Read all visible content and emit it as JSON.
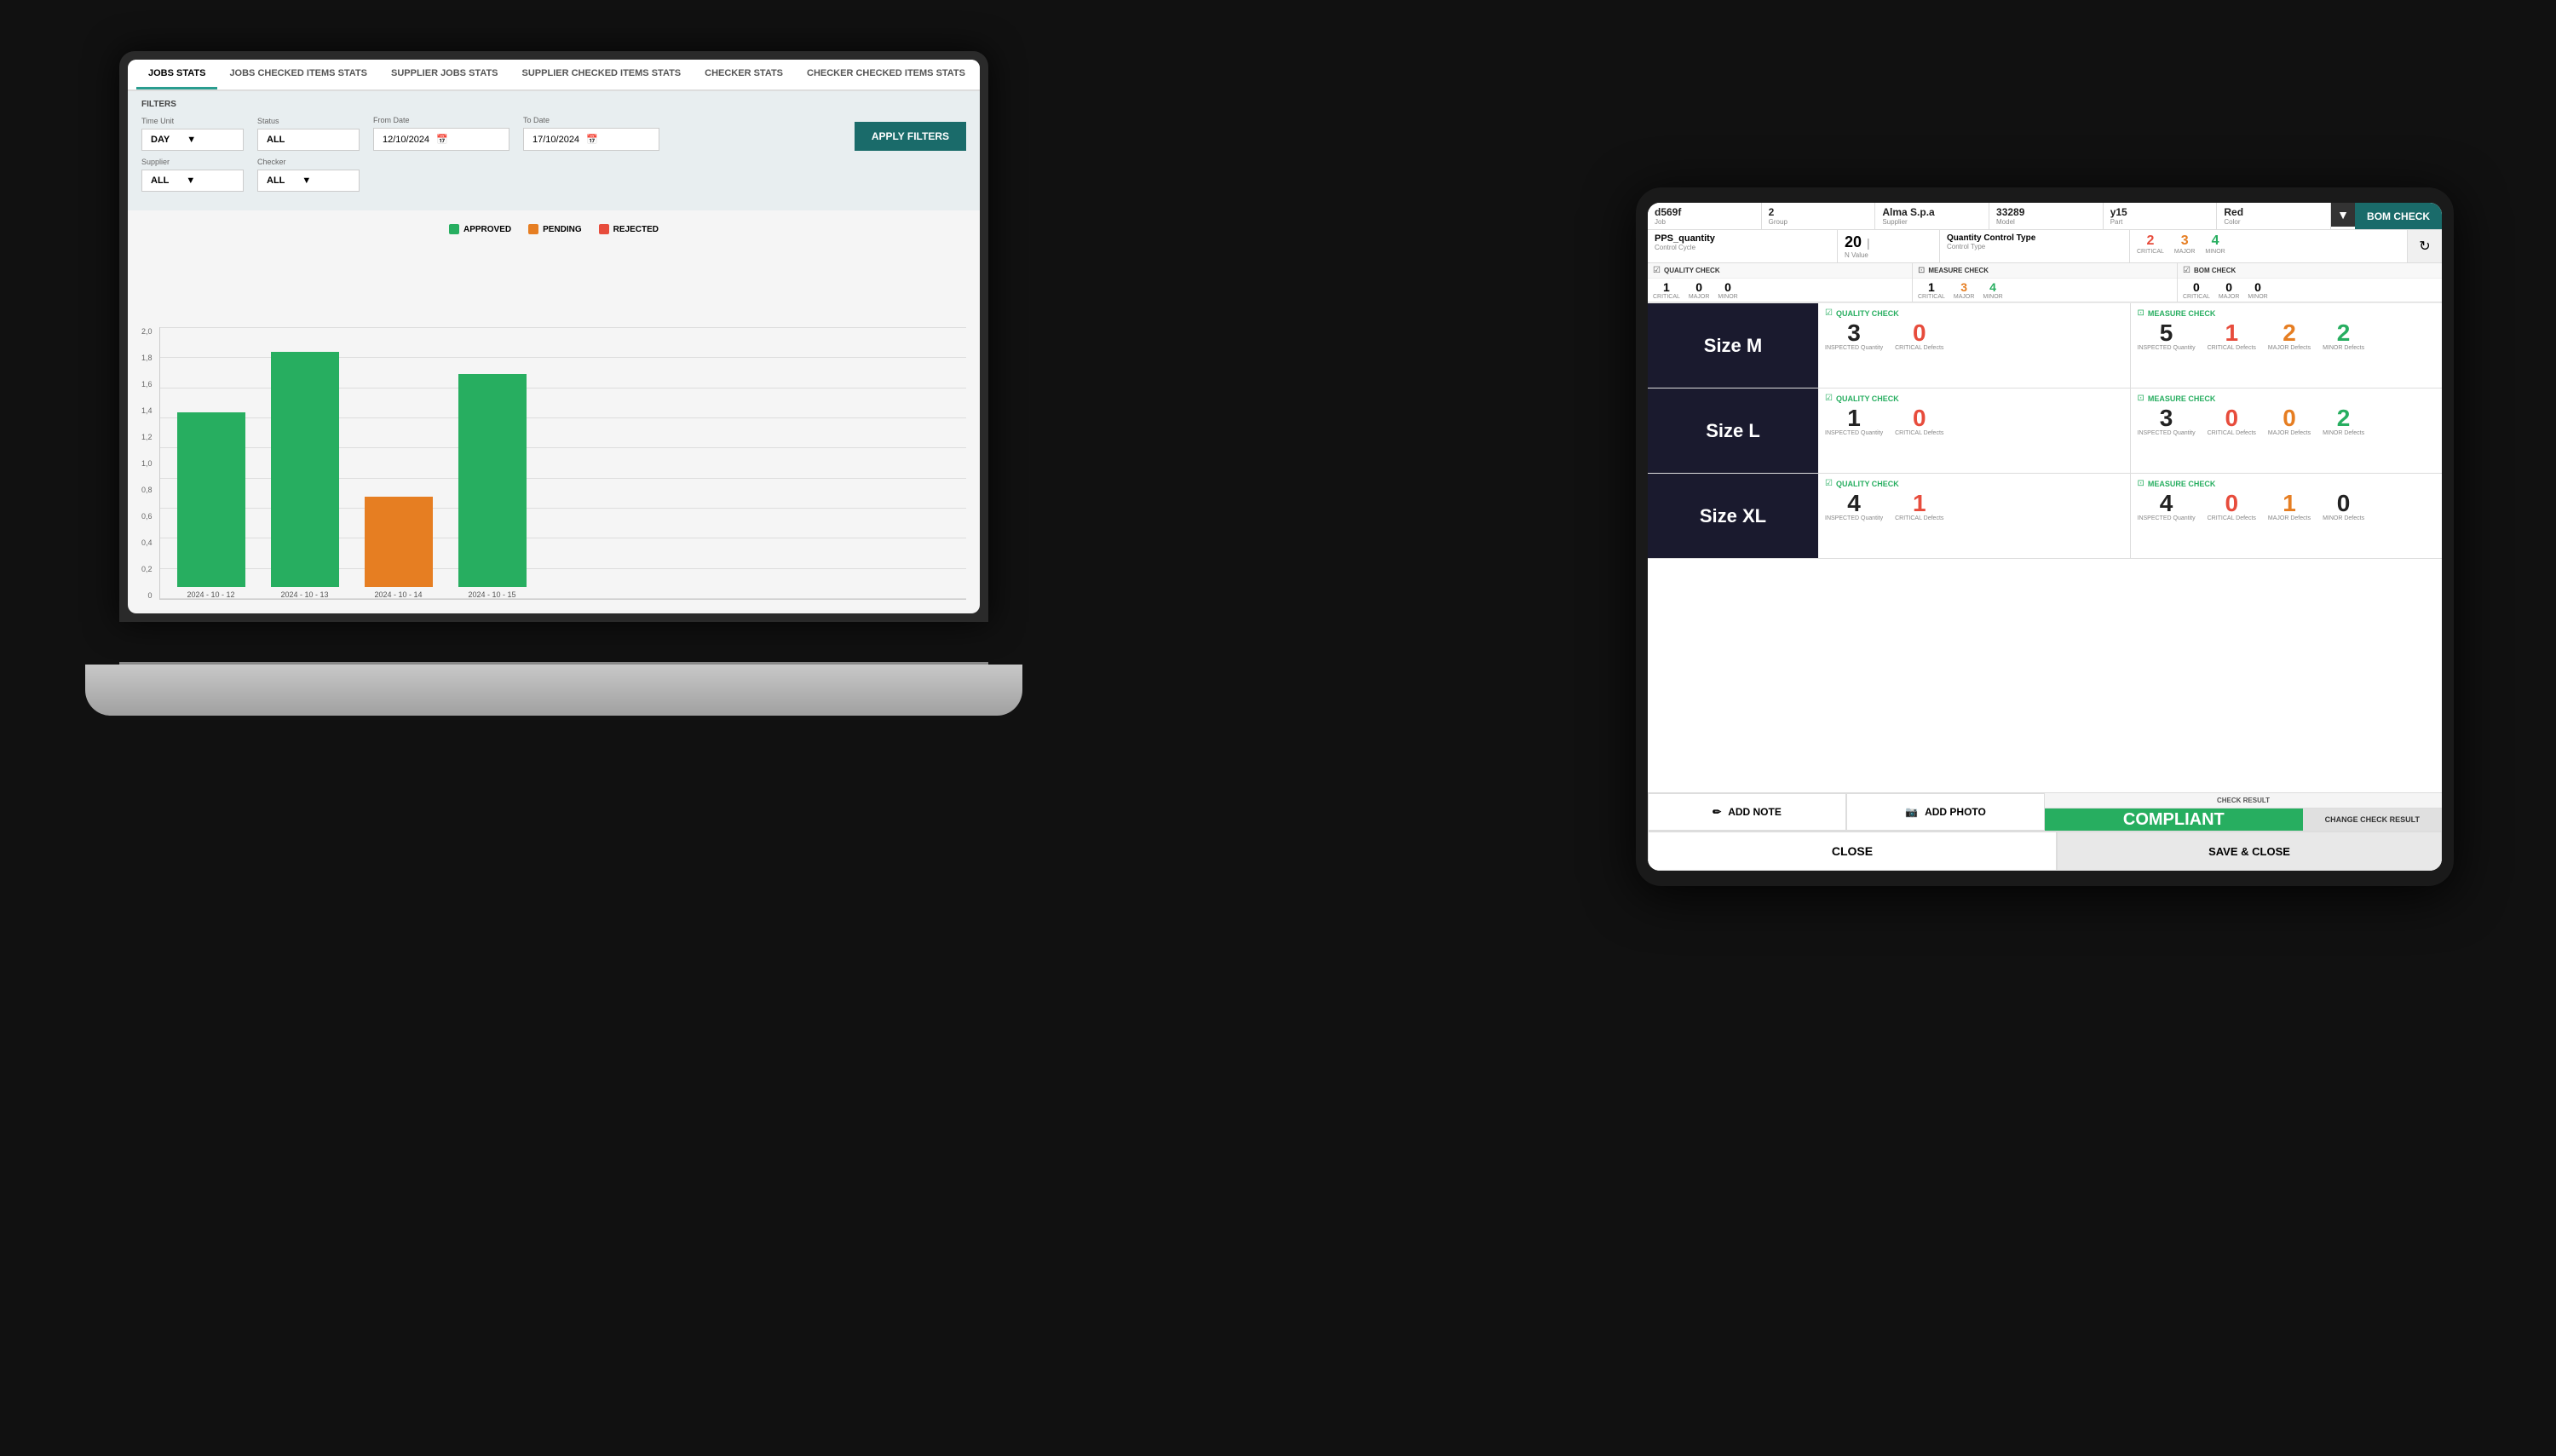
{
  "background": "#111111",
  "laptop": {
    "stats_app": {
      "tabs": [
        {
          "label": "JOBS STATS",
          "active": true
        },
        {
          "label": "JOBS CHECKED ITEMS STATS",
          "active": false
        },
        {
          "label": "SUPPLIER JOBS STATS",
          "active": false
        },
        {
          "label": "SUPPLIER CHECKED ITEMS STATS",
          "active": false
        },
        {
          "label": "CHECKER STATS",
          "active": false
        },
        {
          "label": "CHECKER CHECKED ITEMS STATS",
          "active": false
        }
      ],
      "filters": {
        "title": "FILTERS",
        "time_unit_label": "Time Unit",
        "time_unit_value": "DAY",
        "status_label": "Status",
        "status_value": "ALL",
        "from_date_label": "From Date",
        "from_date_value": "12/10/2024",
        "to_date_label": "To Date",
        "to_date_value": "17/10/2024",
        "supplier_label": "Supplier",
        "supplier_value": "ALL",
        "checker_label": "Checker",
        "checker_value": "ALL",
        "apply_btn": "APPLY FILTERS"
      },
      "chart": {
        "legend": [
          {
            "label": "APPROVED",
            "color": "#27ae60"
          },
          {
            "label": "PENDING",
            "color": "#e67e22"
          },
          {
            "label": "REJECTED",
            "color": "#e74c3c"
          }
        ],
        "y_labels": [
          "0",
          "0,2",
          "0,4",
          "0,6",
          "0,8",
          "1,0",
          "1,2",
          "1,4",
          "1,6",
          "1,8",
          "2,0"
        ],
        "bars": [
          {
            "date": "2024 - 10 - 12",
            "value": 1.28,
            "color": "green"
          },
          {
            "date": "2024 - 10 - 13",
            "value": 1.72,
            "color": "green"
          },
          {
            "date": "2024 - 10 - 14",
            "value": 0.66,
            "color": "orange"
          },
          {
            "date": "2024 - 10 - 15",
            "value": 1.56,
            "color": "green"
          }
        ],
        "max_value": 2.0
      }
    }
  },
  "tablet": {
    "header_cells": [
      {
        "val": "d569f",
        "key": "Job"
      },
      {
        "val": "2",
        "key": "Group"
      },
      {
        "val": "Alma S.p.a",
        "key": "Supplier"
      },
      {
        "val": "33289",
        "key": "Model"
      },
      {
        "val": "y15",
        "key": "Part"
      },
      {
        "val": "Red",
        "key": "Color"
      }
    ],
    "bom_check_btn": "BOM CHECK",
    "qty_row": {
      "name": "PPS_quantity",
      "sub": "Control Cycle",
      "qty_big": "20",
      "qty_sep": "|",
      "qty_sub": "N Value",
      "control_type_label": "Quantity Control Type",
      "control_type_sub": "Control Type",
      "defect_nums": [
        {
          "val": "2",
          "color": "red",
          "sub": "CRITICAL"
        },
        {
          "val": "3",
          "color": "orange",
          "sub": "MAJOR"
        },
        {
          "val": "4",
          "color": "green",
          "sub": "MINOR"
        }
      ]
    },
    "checks": [
      {
        "icon": "☑",
        "title": "QUALITY CHECK",
        "vals": [
          {
            "val": "1",
            "color": "black",
            "label": "CRITICAL"
          },
          {
            "val": "0",
            "color": "black",
            "label": "MAJOR"
          },
          {
            "val": "0",
            "color": "black",
            "label": "MINOR"
          }
        ]
      },
      {
        "icon": "⊡",
        "title": "MEASURE CHECK",
        "vals": [
          {
            "val": "1",
            "color": "black",
            "label": "CRITICAL"
          },
          {
            "val": "3",
            "color": "orange",
            "label": "MAJOR"
          },
          {
            "val": "4",
            "color": "green",
            "label": "MINOR"
          }
        ]
      },
      {
        "icon": "☑",
        "title": "BOM CHECK",
        "vals": [
          {
            "val": "0",
            "color": "black",
            "label": "CRITICAL"
          },
          {
            "val": "0",
            "color": "black",
            "label": "MAJOR"
          },
          {
            "val": "0",
            "color": "black",
            "label": "MINOR"
          }
        ]
      }
    ],
    "sizes": [
      {
        "label": "Size M",
        "quality": {
          "title": "QUALITY CHECK",
          "inspected": "3",
          "critical": "0"
        },
        "measure": {
          "title": "MEASURE CHECK",
          "inspected": "5",
          "critical": "1",
          "major": "2",
          "minor": "2"
        }
      },
      {
        "label": "Size L",
        "quality": {
          "title": "QUALITY CHECK",
          "inspected": "1",
          "critical": "0"
        },
        "measure": {
          "title": "MEASURE CHECK",
          "inspected": "3",
          "critical": "0",
          "major": "0",
          "minor": "2"
        }
      },
      {
        "label": "Size XL",
        "quality": {
          "title": "QUALITY CHECK",
          "inspected": "4",
          "critical": "1"
        },
        "measure": {
          "title": "MEASURE CHECK",
          "inspected": "4",
          "critical": "0",
          "major": "1",
          "minor": "0"
        }
      }
    ],
    "actions": {
      "add_note": "ADD NOTE",
      "add_photo": "ADD PHOTO",
      "close": "CLOSE",
      "check_result_label": "CHECK RESULT",
      "compliant": "COMPLIANT",
      "change_check_result": "CHANGE CHECK RESULT",
      "save_close": "SAVE & CLOSE"
    }
  }
}
